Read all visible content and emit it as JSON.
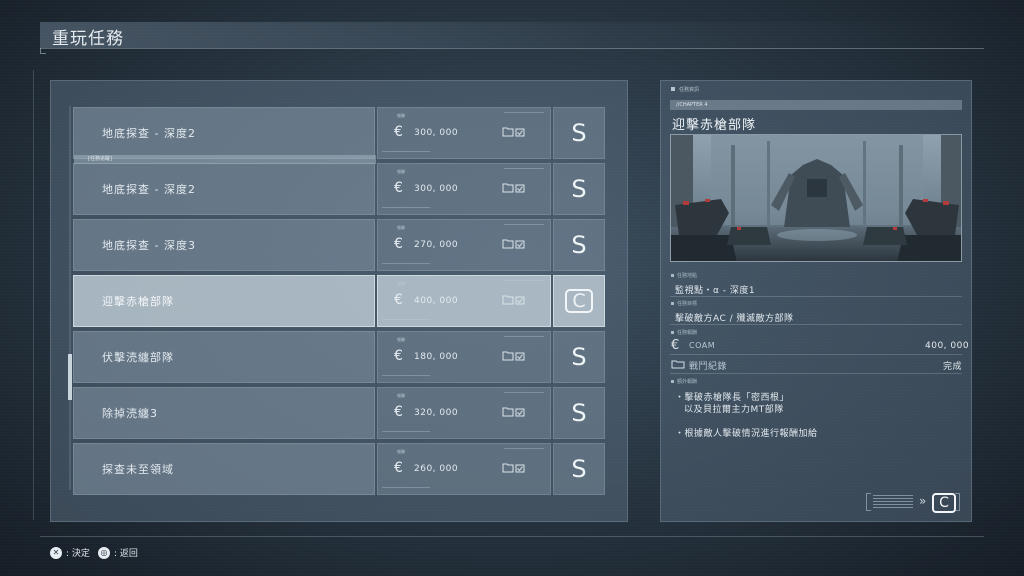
{
  "page": {
    "title": "重玩任務"
  },
  "missions": [
    {
      "name": "地底探查 - 深度2",
      "reward_label": "報酬",
      "reward": "300, 000",
      "rank": "S",
      "tag": ""
    },
    {
      "name": "地底探查 - 深度2",
      "reward_label": "報酬",
      "reward": "300, 000",
      "rank": "S",
      "tag": "[任務追蹤]"
    },
    {
      "name": "地底探查 - 深度3",
      "reward_label": "報酬",
      "reward": "270, 000",
      "rank": "S",
      "tag": ""
    },
    {
      "name": "迎擊赤槍部隊",
      "reward_label": "報酬",
      "reward": "400, 000",
      "rank": "C",
      "tag": ""
    },
    {
      "name": "伏擊涜纏部隊",
      "reward_label": "報酬",
      "reward": "180, 000",
      "rank": "S",
      "tag": ""
    },
    {
      "name": "除掉涜纏3",
      "reward_label": "報酬",
      "reward": "320, 000",
      "rank": "S",
      "tag": ""
    },
    {
      "name": "探查未至領域",
      "reward_label": "報酬",
      "reward": "260, 000",
      "rank": "S",
      "tag": ""
    }
  ],
  "currency_symbol": "€",
  "detail": {
    "heading": "任務資訊",
    "chapter": "//CHAPTER 4",
    "title": "迎擊赤槍部隊",
    "location_label": "任務地點",
    "location": "監視點・α - 深度1",
    "objective_label": "任務目標",
    "objective": "擊破敵方AC / 殲滅敵方部隊",
    "reward_label": "任務報酬",
    "coam_label": "COAM",
    "coam_value": "400, 000",
    "log_label": "戰鬥紀錄",
    "log_value": "完成",
    "bonus_label": "額外報酬",
    "bonus_1_line1": "・擊破赤槍隊長「密西根」",
    "bonus_1_line2": "以及貝拉爾主力MT部隊",
    "bonus_2": "・根據敵人擊破情況進行報酬加給",
    "summary_rank": "C"
  },
  "footer": {
    "confirm_button": "✕",
    "confirm_label": ": 決定",
    "back_button": "◎",
    "back_label": ": 返回"
  }
}
